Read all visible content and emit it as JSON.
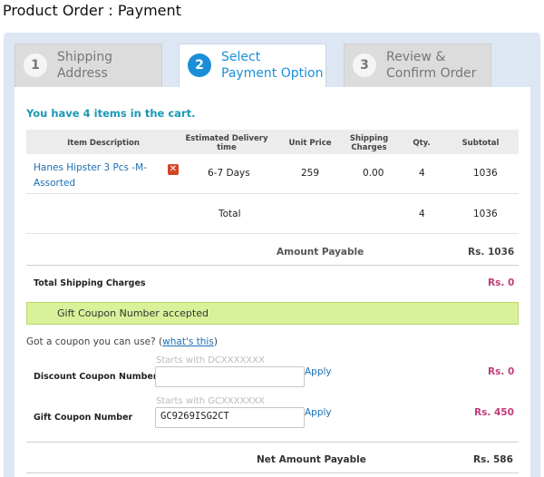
{
  "page": {
    "title": "Product Order : Payment"
  },
  "steps": [
    {
      "number": "1",
      "line1": "Shipping",
      "line2": "Address"
    },
    {
      "number": "2",
      "line1": "Select",
      "line2": "Payment Option"
    },
    {
      "number": "3",
      "line1": "Review &",
      "line2": "Confirm Order"
    }
  ],
  "cart": {
    "prefix": "You have",
    "count": "4",
    "suffix": "items in the cart."
  },
  "table": {
    "headers": {
      "item": "Item Description",
      "delivery1": "Estimated Delivery",
      "delivery2": "time",
      "price": "Unit Price",
      "shipping1": "Shipping",
      "shipping2": "Charges",
      "qty": "Qty.",
      "subtotal": "Subtotal"
    },
    "row": {
      "item1": "Hanes Hipster 3 Pcs -M-",
      "item2": "Assorted",
      "delivery": "6-7 Days",
      "price": "259",
      "shipping": "0.00",
      "qty": "4",
      "subtotal": "1036"
    },
    "total": {
      "label": "Total",
      "qty": "4",
      "subtotal": "1036"
    }
  },
  "summary": {
    "amount_payable_label": "Amount Payable",
    "amount_payable_value": "Rs. 1036",
    "shipping_label": "Total Shipping Charges",
    "shipping_value": "Rs. 0",
    "gift_accepted": "Gift Coupon Number accepted",
    "coupon_prompt": "Got a coupon you can use? (",
    "coupon_link": "what's this",
    "coupon_prompt_end": ")",
    "discount_label": "Discount Coupon Number",
    "discount_hint": "Starts with DCXXXXXXX",
    "discount_value_input": "",
    "discount_apply": "Apply",
    "discount_value": "Rs. 0",
    "gift_label": "Gift Coupon Number",
    "gift_hint": "Starts with GCXXXXXXX",
    "gift_value_input": "GC9269ISG2CT",
    "gift_apply": "Apply",
    "gift_value": "Rs. 450",
    "net_label": "Net Amount Payable",
    "net_value": "Rs. 586"
  },
  "colors": {
    "accent": "#1a8fd8",
    "pink": "#c23b7b",
    "banner": "#d9f29a",
    "remove": "#d24625"
  }
}
